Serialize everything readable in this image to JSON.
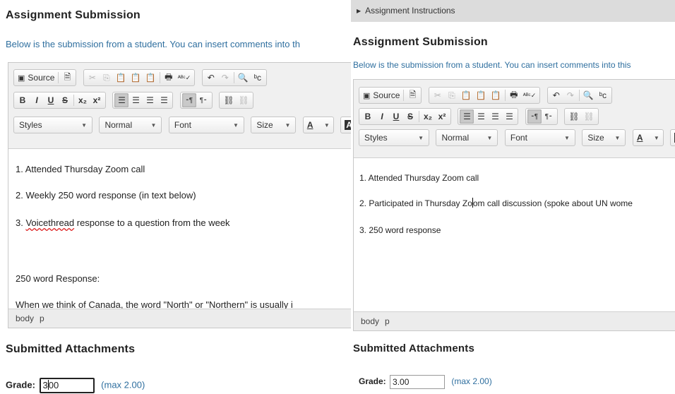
{
  "left": {
    "title": "Assignment Submission",
    "intro": "Below is the submission from a student. You can insert comments into th",
    "toolbar": {
      "source_label": "Source",
      "styles_label": "Styles",
      "format_label": "Normal",
      "font_label": "Font",
      "size_label": "Size"
    },
    "content": {
      "line1": "1. Attended Thursday Zoom call",
      "line2": "2. Weekly 250 word response (in text below)",
      "line3_prefix": "3. ",
      "line3_misspelled": "Voicethread",
      "line3_suffix": " response to a question from the week",
      "line4": "250 word Response:",
      "line5": "When we think of Canada, the word \"North\" or \"Northern\" is usually i"
    },
    "status": {
      "path1": "body",
      "path2": "p"
    },
    "attachments_title": "Submitted Attachments",
    "grade": {
      "label": "Grade:",
      "value_before_caret": "3",
      "value_after_caret": "00",
      "max": "(max 2.00)"
    }
  },
  "right": {
    "instructions_label": "Assignment Instructions",
    "title": "Assignment Submission",
    "intro": "Below is the submission from a student. You can insert comments into this",
    "toolbar": {
      "source_label": "Source",
      "styles_label": "Styles",
      "format_label": "Normal",
      "font_label": "Font",
      "size_label": "Size"
    },
    "content": {
      "line1": "1. Attended Thursday Zoom call",
      "line2_before_caret": "2. Participated in Thursday Zo",
      "line2_after_caret": "om call discussion (spoke about UN wome",
      "line3": "3. 250 word response"
    },
    "status": {
      "path1": "body",
      "path2": "p"
    },
    "attachments_title": "Submitted Attachments",
    "grade": {
      "label": "Grade:",
      "value": "3.00",
      "max": "(max 2.00)"
    }
  }
}
